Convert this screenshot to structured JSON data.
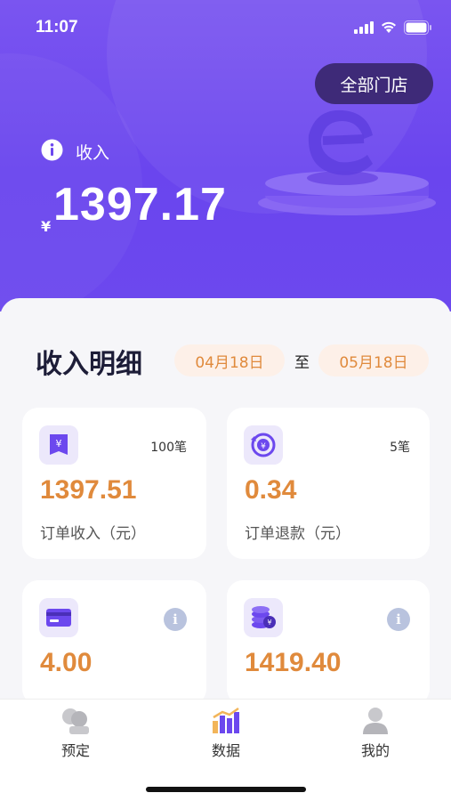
{
  "status_bar": {
    "time": "11:07"
  },
  "header": {
    "store_button": "全部门店",
    "income_label": "收入",
    "currency": "¥",
    "income_value": "1397.17"
  },
  "detail": {
    "title": "收入明细",
    "date_from": "04月18日",
    "separator": "至",
    "date_to": "05月18日"
  },
  "cards": [
    {
      "count": "100笔",
      "value": "1397.51",
      "label": "订单收入（元）",
      "icon": "yen-receipt-icon"
    },
    {
      "count": "5笔",
      "value": "0.34",
      "label": "订单退款（元）",
      "icon": "refund-icon"
    },
    {
      "value": "4.00",
      "icon": "card-icon",
      "info": "i"
    },
    {
      "value": "1419.40",
      "icon": "coins-icon",
      "info": "i"
    }
  ],
  "tabbar": {
    "items": [
      {
        "label": "预定",
        "icon": "booking-icon"
      },
      {
        "label": "数据",
        "icon": "chart-icon"
      },
      {
        "label": "我的",
        "icon": "profile-icon"
      }
    ]
  },
  "colors": {
    "accent": "#6c48ee",
    "amount": "#e08a3c",
    "date_bg": "#fdf0e8"
  }
}
